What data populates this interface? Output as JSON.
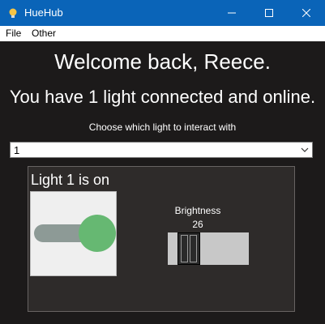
{
  "window": {
    "title": "HueHub",
    "icon": "lightbulb-icon",
    "controls": [
      "minimize-icon",
      "maximize-icon",
      "close-icon"
    ]
  },
  "menu": {
    "file": "File",
    "other": "Other"
  },
  "main": {
    "welcome": "Welcome back, Reece.",
    "status": "You have 1 light connected and online.",
    "choose_label": "Choose which light to interact with",
    "selected_light": "1"
  },
  "light_panel": {
    "status": "Light 1 is on",
    "power_on": true,
    "brightness_label": "Brightness",
    "brightness_value": "26",
    "brightness_level": 0.26
  },
  "colors": {
    "titlebar": "#0a64b8",
    "background": "#1c1a1a",
    "panel": "#2e2b2a",
    "toggle_on": "#66b872"
  }
}
